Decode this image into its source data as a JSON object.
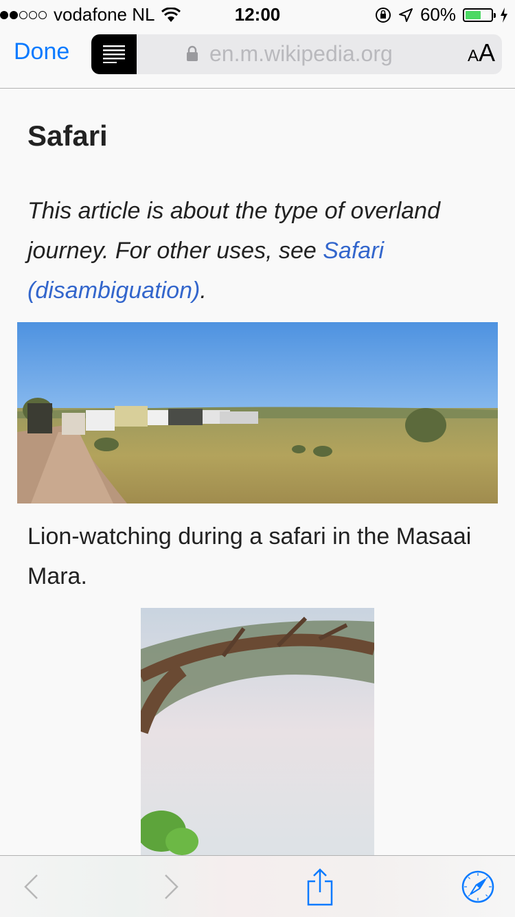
{
  "status_bar": {
    "carrier": "vodafone NL",
    "time": "12:00",
    "battery": "60%",
    "battery_level": 0.6
  },
  "nav": {
    "done_label": "Done",
    "url": "en.m.wikipedia.org",
    "text_size_small": "A",
    "text_size_large": "A"
  },
  "article": {
    "title": "Safari",
    "hatnote_prefix": "This article is about the type of overland journey. For other uses, see ",
    "hatnote_link": "Safari (disambiguation)",
    "hatnote_suffix": ".",
    "caption1": "Lion-watching during a safari in the Masaai Mara."
  },
  "colors": {
    "accent": "#0a7aff",
    "link": "#3366cc",
    "sky": "#5a9be0",
    "grass": "#a89a52"
  },
  "toolbar": {
    "icons": [
      "back-icon",
      "forward-icon",
      "share-icon",
      "compass-icon"
    ]
  }
}
